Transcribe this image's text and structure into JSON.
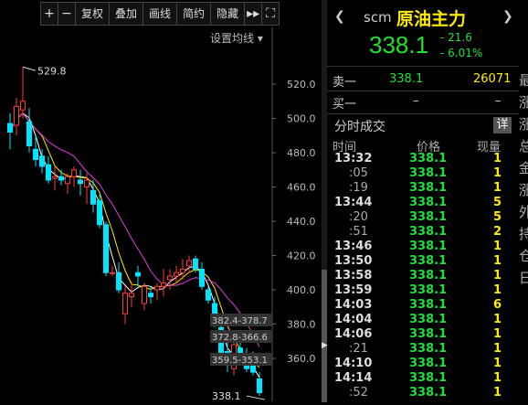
{
  "toolbar": {
    "plus": "+",
    "minus": "−",
    "adjust": "复权",
    "overlay": "叠加",
    "draw": "画线",
    "simple": "简约",
    "hide": "隐藏",
    "more": "▸▸",
    "fullscreen": "⛶"
  },
  "ma_setting": "设置均线",
  "chart_data": {
    "type": "candlestick",
    "y_axis": [
      520.0,
      500.0,
      480.0,
      460.0,
      440.0,
      420.0,
      400.0,
      380.0,
      360.0
    ],
    "ylim": [
      333,
      533
    ],
    "annotations": {
      "high": "529.8",
      "low": "338.1"
    },
    "range_labels": [
      "382.4-378.7",
      "372.8-366.6",
      "359.5-353.1"
    ],
    "colors": {
      "up": "#ff3b3b",
      "down": "#00e5ff",
      "ma_white": "#ffffff",
      "ma_yellow": "#ffea00",
      "ma_magenta": "#e03ce0"
    },
    "candles": [
      {
        "o": 497,
        "h": 503,
        "l": 482,
        "c": 492
      },
      {
        "o": 496,
        "h": 512,
        "l": 490,
        "c": 507
      },
      {
        "o": 505,
        "h": 530,
        "l": 500,
        "c": 510
      },
      {
        "o": 498,
        "h": 506,
        "l": 480,
        "c": 484
      },
      {
        "o": 482,
        "h": 490,
        "l": 472,
        "c": 476
      },
      {
        "o": 478,
        "h": 482,
        "l": 468,
        "c": 472
      },
      {
        "o": 473,
        "h": 478,
        "l": 462,
        "c": 464
      },
      {
        "o": 465,
        "h": 472,
        "l": 458,
        "c": 466
      },
      {
        "o": 466,
        "h": 470,
        "l": 461,
        "c": 464
      },
      {
        "o": 462,
        "h": 468,
        "l": 456,
        "c": 466
      },
      {
        "o": 466,
        "h": 472,
        "l": 460,
        "c": 470
      },
      {
        "o": 464,
        "h": 470,
        "l": 455,
        "c": 462
      },
      {
        "o": 460,
        "h": 468,
        "l": 450,
        "c": 464
      },
      {
        "o": 458,
        "h": 464,
        "l": 445,
        "c": 450
      },
      {
        "o": 452,
        "h": 456,
        "l": 436,
        "c": 438
      },
      {
        "o": 438,
        "h": 440,
        "l": 408,
        "c": 410
      },
      {
        "o": 410,
        "h": 414,
        "l": 408,
        "c": 410
      },
      {
        "o": 410,
        "h": 416,
        "l": 398,
        "c": 400
      },
      {
        "o": 386,
        "h": 402,
        "l": 380,
        "c": 398
      },
      {
        "o": 396,
        "h": 405,
        "l": 390,
        "c": 398
      },
      {
        "o": 410,
        "h": 414,
        "l": 402,
        "c": 408
      },
      {
        "o": 392,
        "h": 404,
        "l": 388,
        "c": 402
      },
      {
        "o": 398,
        "h": 402,
        "l": 392,
        "c": 396
      },
      {
        "o": 400,
        "h": 404,
        "l": 394,
        "c": 402
      },
      {
        "o": 402,
        "h": 412,
        "l": 396,
        "c": 404
      },
      {
        "o": 406,
        "h": 412,
        "l": 400,
        "c": 408
      },
      {
        "o": 408,
        "h": 414,
        "l": 404,
        "c": 410
      },
      {
        "o": 410,
        "h": 418,
        "l": 406,
        "c": 412
      },
      {
        "o": 414,
        "h": 420,
        "l": 410,
        "c": 417
      },
      {
        "o": 418,
        "h": 420,
        "l": 410,
        "c": 412
      },
      {
        "o": 412,
        "h": 416,
        "l": 400,
        "c": 402
      },
      {
        "o": 400,
        "h": 402,
        "l": 392,
        "c": 394
      },
      {
        "o": 392,
        "h": 396,
        "l": 378,
        "c": 380
      },
      {
        "o": 378,
        "h": 382,
        "l": 360,
        "c": 362
      },
      {
        "o": 364,
        "h": 372,
        "l": 352,
        "c": 356
      },
      {
        "o": 354,
        "h": 372,
        "l": 350,
        "c": 368
      },
      {
        "o": 366,
        "h": 372,
        "l": 358,
        "c": 360
      },
      {
        "o": 360,
        "h": 366,
        "l": 352,
        "c": 354
      },
      {
        "o": 356,
        "h": 364,
        "l": 350,
        "c": 352
      },
      {
        "o": 348,
        "h": 352,
        "l": 338,
        "c": 340
      }
    ]
  },
  "quote": {
    "code": "scm",
    "name": "原油主力",
    "price": "338.1",
    "change": "- 21.6",
    "change_pct": "- 6.01%"
  },
  "orderbook": {
    "sell_label": "卖一",
    "sell_price": "338.1",
    "sell_vol": "26071",
    "buy_label": "买一",
    "buy_price": "–",
    "buy_vol": "–"
  },
  "ticks": {
    "title": "分时成交",
    "detail_button": "详",
    "headers": {
      "time": "时间",
      "price": "价格",
      "vol": "现量"
    },
    "rows": [
      {
        "t": "13:32",
        "p": "338.1",
        "v": "1",
        "sec": false
      },
      {
        "t": ":05",
        "p": "338.1",
        "v": "1",
        "sec": true
      },
      {
        "t": ":19",
        "p": "338.1",
        "v": "1",
        "sec": true
      },
      {
        "t": "13:44",
        "p": "338.1",
        "v": "5",
        "sec": false
      },
      {
        "t": ":20",
        "p": "338.1",
        "v": "5",
        "sec": true
      },
      {
        "t": ":51",
        "p": "338.1",
        "v": "2",
        "sec": true
      },
      {
        "t": "13:46",
        "p": "338.1",
        "v": "1",
        "sec": false
      },
      {
        "t": "13:50",
        "p": "338.1",
        "v": "1",
        "sec": false
      },
      {
        "t": "13:58",
        "p": "338.1",
        "v": "1",
        "sec": false
      },
      {
        "t": "13:59",
        "p": "338.1",
        "v": "1",
        "sec": false
      },
      {
        "t": "14:03",
        "p": "338.1",
        "v": "6",
        "sec": false
      },
      {
        "t": "14:04",
        "p": "338.1",
        "v": "1",
        "sec": false
      },
      {
        "t": "14:06",
        "p": "338.1",
        "v": "1",
        "sec": false
      },
      {
        "t": ":21",
        "p": "338.1",
        "v": "1",
        "sec": true
      },
      {
        "t": "14:10",
        "p": "338.1",
        "v": "1",
        "sec": false
      },
      {
        "t": "14:14",
        "p": "338.1",
        "v": "1",
        "sec": false
      },
      {
        "t": ":52",
        "p": "338.1",
        "v": "1",
        "sec": true
      }
    ]
  },
  "side_chars": [
    "最",
    "涨",
    "涨",
    "总",
    "金",
    "涨",
    "外",
    "持",
    "仓",
    "日"
  ]
}
